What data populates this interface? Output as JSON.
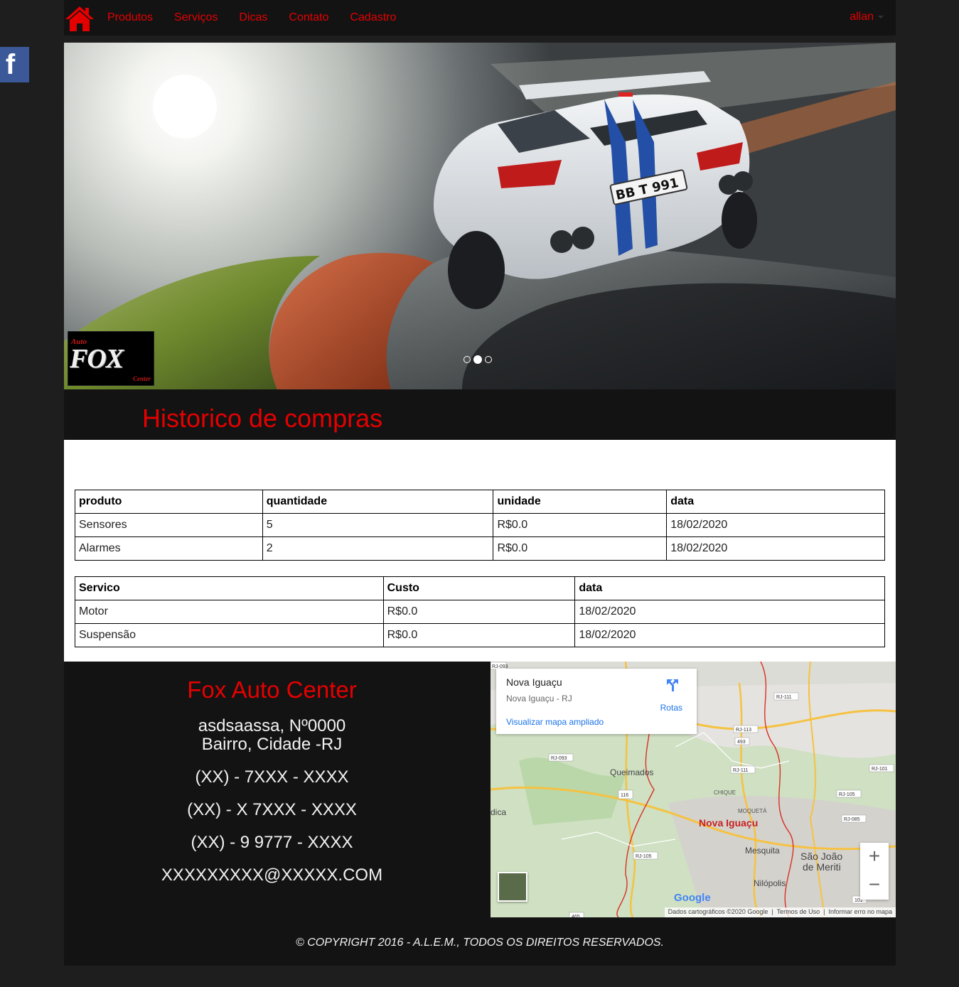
{
  "navbar": {
    "items": [
      "Produtos",
      "Serviços",
      "Dicas",
      "Contato",
      "Cadastro"
    ],
    "user": "allan"
  },
  "hero": {
    "plate": "BB T 991",
    "logo_auto": "Auto",
    "logo_fox": "FOX",
    "logo_center": "Center",
    "slide_count": 3,
    "active_slide": 2
  },
  "page_title": "Historico de compras",
  "produtos_table": {
    "headers": [
      "produto",
      "quantidade",
      "unidade",
      "data"
    ],
    "rows": [
      [
        "Sensores",
        "5",
        "R$0.0",
        "18/02/2020"
      ],
      [
        "Alarmes",
        "2",
        "R$0.0",
        "18/02/2020"
      ]
    ]
  },
  "servicos_table": {
    "headers": [
      "Servico",
      "Custo",
      "data"
    ],
    "rows": [
      [
        "Motor",
        "R$0.0",
        "18/02/2020"
      ],
      [
        "Suspensão",
        "R$0.0",
        "18/02/2020"
      ]
    ]
  },
  "footer": {
    "company": "Fox Auto Center",
    "address_line1": "asdsaassa, Nº0000",
    "address_line2": "Bairro, Cidade -RJ",
    "phone1": "(XX) - 7XXX - XXXX",
    "phone2": "(XX) - X 7XXX - XXXX",
    "phone3": "(XX) - 9 9777 - XXXX",
    "email": "XXXXXXXXX@XXXXX.COM",
    "copyright": "© COPYRIGHT 2016 - A.L.E.M., TODOS OS DIREITOS RESERVADOS."
  },
  "map": {
    "place_name": "Nova Iguaçu",
    "place_sub": "Nova Iguaçu - RJ",
    "directions_label": "Rotas",
    "larger_map_link": "Visualizar mapa ampliado",
    "labels": [
      "Queimados",
      "CHIQUE",
      "MOQUETÁ",
      "Nova Iguaçu",
      "Mesquita",
      "São João",
      "de Meriti",
      "Nilópolis",
      "dica"
    ],
    "road_labels": [
      "RJ-093",
      "RJ-093",
      "RJ-111",
      "RJ-113",
      "493",
      "RJ-111",
      "RJ-101",
      "116",
      "RJ-105",
      "RJ-085",
      "RJ-105",
      "465",
      "101"
    ],
    "zoom_in": "+",
    "zoom_out": "−",
    "google": "Google",
    "footer_data": "Dados cartográficos ©2020 Google",
    "footer_terms": "Termos de Uso",
    "footer_report": "Informar erro no mapa"
  },
  "social": {
    "facebook": "f"
  },
  "colors": {
    "accent": "#e50000",
    "dark": "#131313",
    "page_bg": "#1e1e1e",
    "facebook": "#3b5998"
  }
}
